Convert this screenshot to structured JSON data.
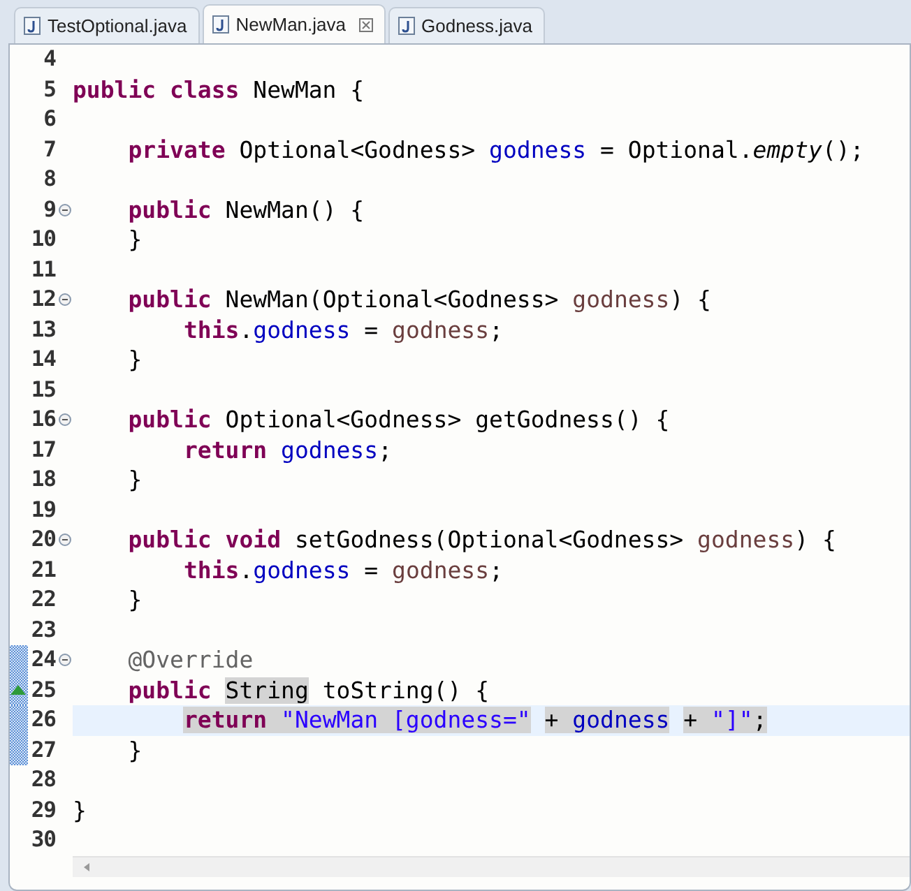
{
  "tabs": [
    {
      "label": "TestOptional.java",
      "selected": false
    },
    {
      "label": "NewMan.java",
      "selected": true,
      "closable": true
    },
    {
      "label": "Godness.java",
      "selected": false
    }
  ],
  "editor": {
    "lines": [
      {
        "n": "4"
      },
      {
        "n": "5",
        "tokens": [
          {
            "kind": "kw",
            "t": "public class "
          },
          {
            "kind": "plain",
            "t": "NewMan {"
          }
        ]
      },
      {
        "n": "6"
      },
      {
        "n": "7",
        "tokens": [
          {
            "kind": "kw",
            "t": "    private "
          },
          {
            "kind": "plain",
            "t": "Optional<Godness> "
          },
          {
            "kind": "field",
            "t": "godness"
          },
          {
            "kind": "plain",
            "t": " = Optional."
          },
          {
            "kind": "static",
            "t": "empty"
          },
          {
            "kind": "plain",
            "t": "();"
          }
        ]
      },
      {
        "n": "8"
      },
      {
        "n": "9",
        "fold": true,
        "tokens": [
          {
            "kind": "kw",
            "t": "    public "
          },
          {
            "kind": "plain",
            "t": "NewMan() {"
          }
        ]
      },
      {
        "n": "10",
        "tokens": [
          {
            "kind": "plain",
            "t": "    }"
          }
        ]
      },
      {
        "n": "11"
      },
      {
        "n": "12",
        "fold": true,
        "tokens": [
          {
            "kind": "kw",
            "t": "    public "
          },
          {
            "kind": "plain",
            "t": "NewMan(Optional<Godness> "
          },
          {
            "kind": "local",
            "t": "godness"
          },
          {
            "kind": "plain",
            "t": ") {"
          }
        ]
      },
      {
        "n": "13",
        "tokens": [
          {
            "kind": "kw",
            "t": "        this"
          },
          {
            "kind": "plain",
            "t": "."
          },
          {
            "kind": "field",
            "t": "godness"
          },
          {
            "kind": "plain",
            "t": " = "
          },
          {
            "kind": "local",
            "t": "godness"
          },
          {
            "kind": "plain",
            "t": ";"
          }
        ]
      },
      {
        "n": "14",
        "tokens": [
          {
            "kind": "plain",
            "t": "    }"
          }
        ]
      },
      {
        "n": "15"
      },
      {
        "n": "16",
        "fold": true,
        "tokens": [
          {
            "kind": "kw",
            "t": "    public "
          },
          {
            "kind": "plain",
            "t": "Optional<Godness> getGodness() {"
          }
        ]
      },
      {
        "n": "17",
        "tokens": [
          {
            "kind": "kw",
            "t": "        return "
          },
          {
            "kind": "field",
            "t": "godness"
          },
          {
            "kind": "plain",
            "t": ";"
          }
        ]
      },
      {
        "n": "18",
        "tokens": [
          {
            "kind": "plain",
            "t": "    }"
          }
        ]
      },
      {
        "n": "19"
      },
      {
        "n": "20",
        "fold": true,
        "tokens": [
          {
            "kind": "kw",
            "t": "    public void "
          },
          {
            "kind": "plain",
            "t": "setGodness(Optional<Godness> "
          },
          {
            "kind": "local",
            "t": "godness"
          },
          {
            "kind": "plain",
            "t": ") {"
          }
        ]
      },
      {
        "n": "21",
        "tokens": [
          {
            "kind": "kw",
            "t": "        this"
          },
          {
            "kind": "plain",
            "t": "."
          },
          {
            "kind": "field",
            "t": "godness"
          },
          {
            "kind": "plain",
            "t": " = "
          },
          {
            "kind": "local",
            "t": "godness"
          },
          {
            "kind": "plain",
            "t": ";"
          }
        ]
      },
      {
        "n": "22",
        "tokens": [
          {
            "kind": "plain",
            "t": "    }"
          }
        ]
      },
      {
        "n": "23"
      },
      {
        "n": "24",
        "fold": true,
        "changed": true,
        "tokens": [
          {
            "kind": "ann",
            "t": "    @Override"
          }
        ]
      },
      {
        "n": "25",
        "changed": true,
        "override": true,
        "tokens": [
          {
            "kind": "kw",
            "t": "    public "
          },
          {
            "kind": "plain",
            "t": "String",
            "marked": true
          },
          {
            "kind": "plain",
            "t": " toString() {"
          }
        ]
      },
      {
        "n": "26",
        "changed": true,
        "current": true,
        "tokens": [
          {
            "kind": "kw",
            "t": "        return ",
            "marked": true
          },
          {
            "kind": "str",
            "t": "\"NewMan [godness=\"",
            "marked": true
          },
          {
            "kind": "plain",
            "t": " + ",
            "marked": true
          },
          {
            "kind": "field",
            "t": "godness",
            "marked": true
          },
          {
            "kind": "plain",
            "t": " + ",
            "marked": true
          },
          {
            "kind": "str",
            "t": "\"]\"",
            "marked": true
          },
          {
            "kind": "plain",
            "t": ";",
            "marked": true
          }
        ]
      },
      {
        "n": "27",
        "changed": true,
        "tokens": [
          {
            "kind": "plain",
            "t": "    }"
          }
        ]
      },
      {
        "n": "28"
      },
      {
        "n": "29",
        "tokens": [
          {
            "kind": "plain",
            "t": "}"
          }
        ]
      },
      {
        "n": "30"
      }
    ]
  }
}
